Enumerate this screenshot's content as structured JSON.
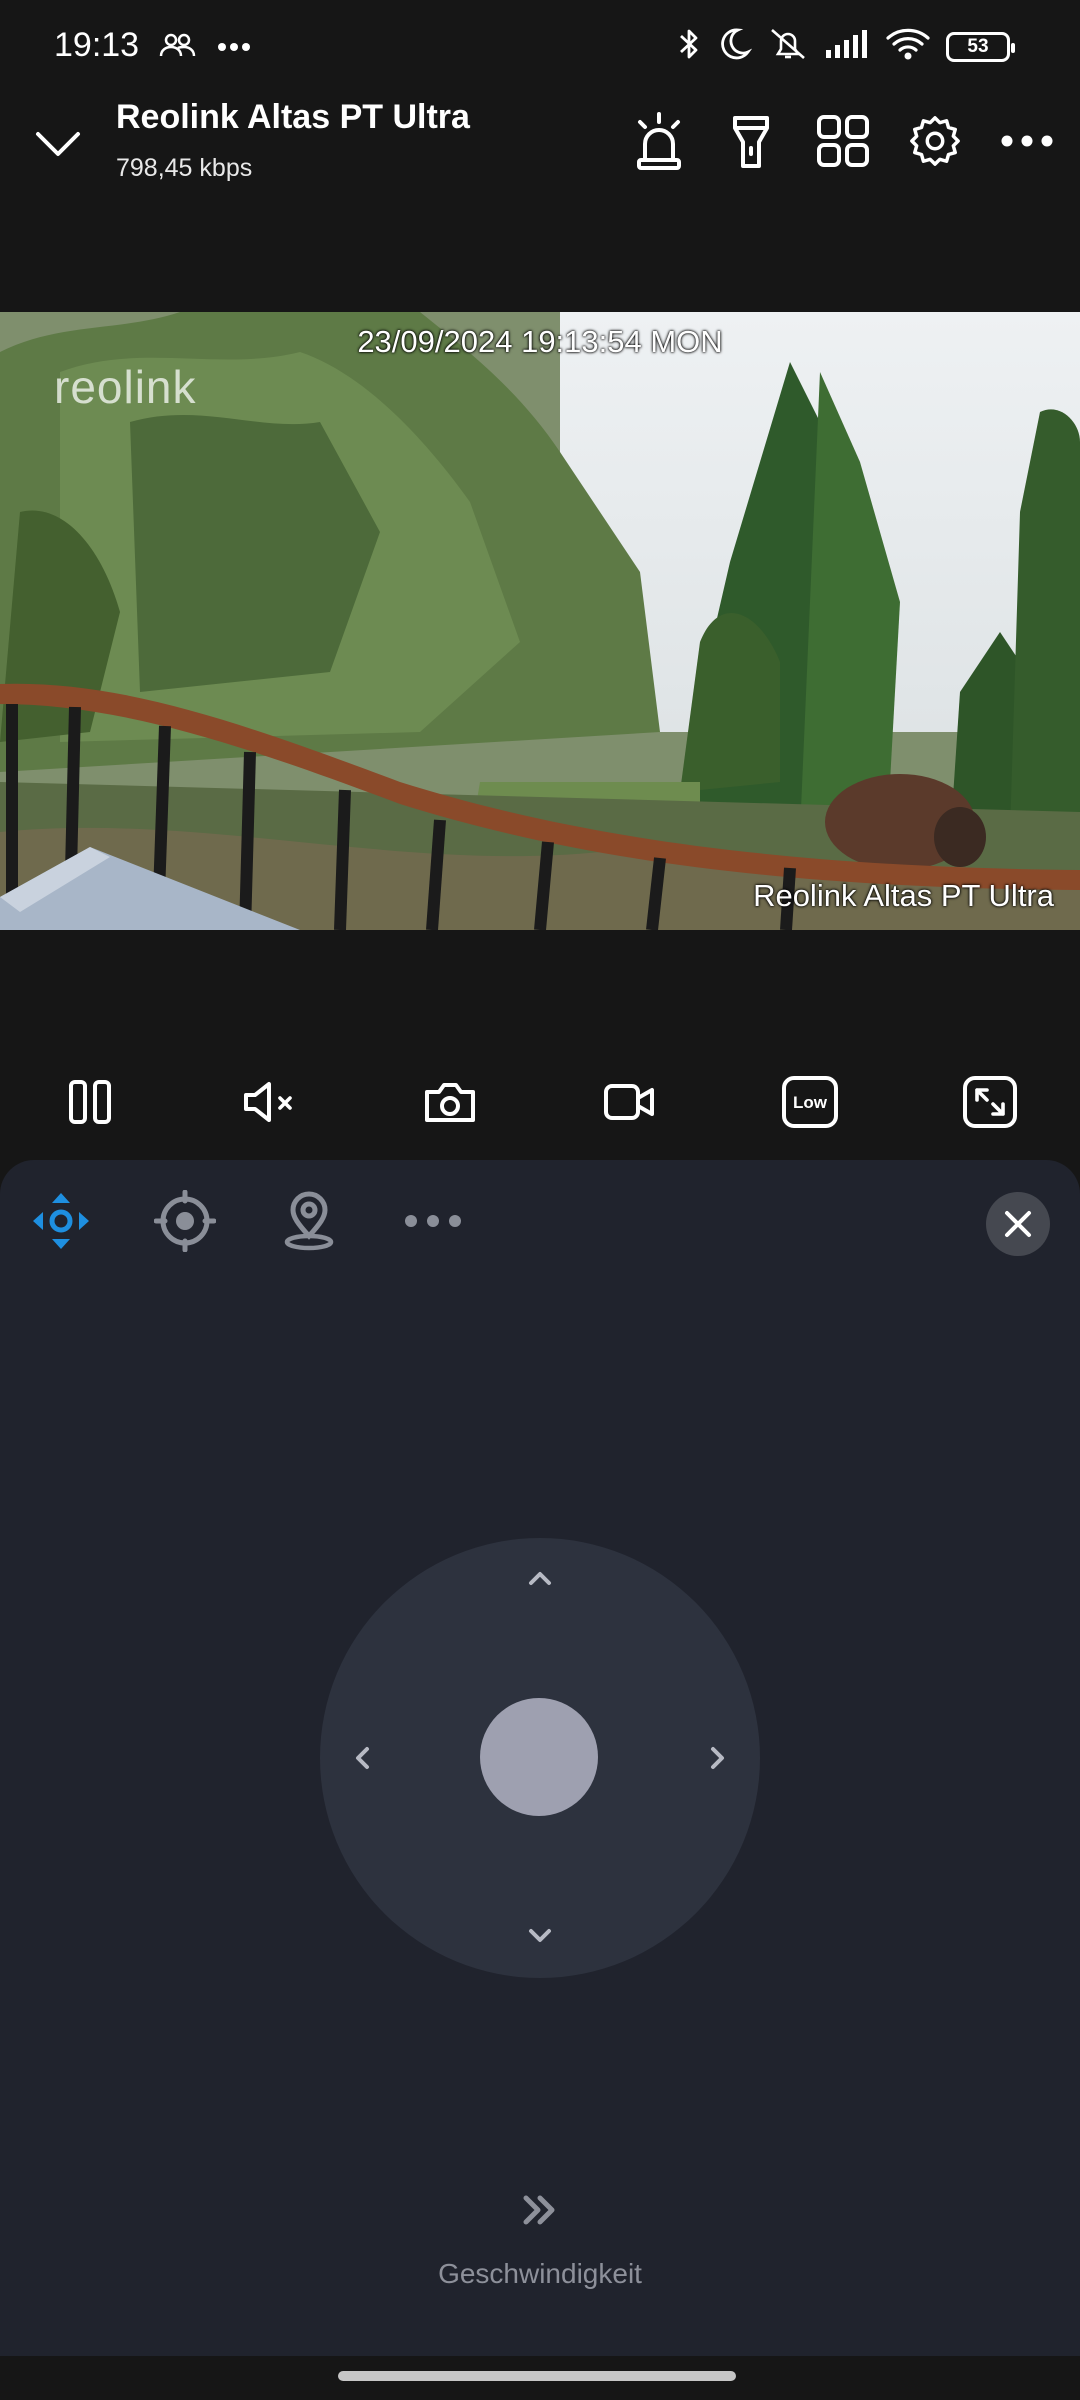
{
  "status_bar": {
    "time": "19:13",
    "battery": "53"
  },
  "header": {
    "title": "Reolink Altas PT Ultra",
    "bitrate": "798,45 kbps"
  },
  "video": {
    "timestamp": "23/09/2024 19:13:54 MON",
    "watermark": "reolink",
    "camera_label": "Reolink Altas PT Ultra"
  },
  "controls": {
    "quality_label": "Low"
  },
  "panel": {
    "speed_label": "Geschwindigkeit",
    "accent_color": "#1e8fe0"
  }
}
